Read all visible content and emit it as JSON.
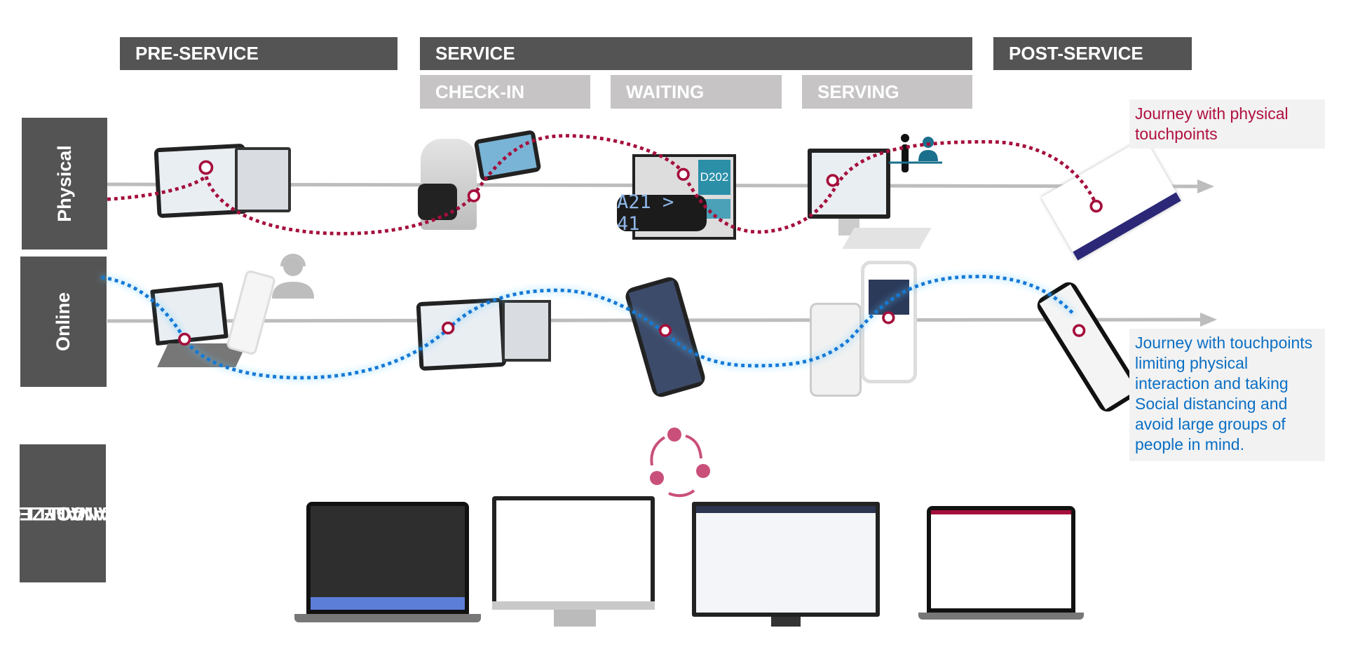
{
  "phases": {
    "pre_service": "PRE-SERVICE",
    "service": "SERVICE",
    "post_service": "POST-SERVICE",
    "sub": [
      "CHECK-IN",
      "WAITING",
      "SERVING"
    ]
  },
  "rows": {
    "physical": "Physical",
    "online": "Online",
    "collect": [
      "COLLECT",
      "ANALYZE",
      "MANAGE"
    ]
  },
  "notes": {
    "physical": "Journey with physical touchpoints",
    "online": "Journey with touchpoints limiting physical interaction and  taking Social distancing and avoid large groups of people in mind."
  },
  "devices": {
    "waiting_display_ticket": "D202",
    "led_sign": "A21 > 41"
  },
  "colors": {
    "phase_bar": "#545454",
    "sub_phase_bar": "#c6c4c4",
    "physical_path": "#a50f3c",
    "online_path": "#0b6fc4",
    "cycle_icon": "#c9507a"
  },
  "icons": [
    "tablet",
    "kiosk",
    "waiting-display",
    "led-sign",
    "desktop-pc",
    "staff-counter",
    "feedback-device",
    "laptop",
    "smartphone",
    "headset-agent",
    "cycle-arrows",
    "dashboard-screens"
  ]
}
